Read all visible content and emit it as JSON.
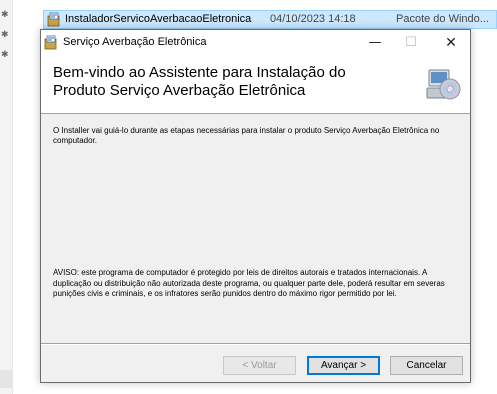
{
  "explorer": {
    "file_name": "InstaladorServicoAverbacaoEletronica",
    "file_date": "04/10/2023 14:18",
    "file_type": "Pacote do Windo..."
  },
  "window": {
    "title": "Serviço Averbação Eletrônica",
    "minimize_glyph": "—",
    "maximize_glyph": "☐",
    "close_glyph": "✕"
  },
  "banner": {
    "title_line1": "Bem-vindo ao Assistente para Instalação do",
    "title_line2": "Produto Serviço Averbação Eletrônica"
  },
  "content": {
    "intro": "O Installer vai guiá-lo durante as etapas necessárias para instalar o produto Serviço Averbação Eletrônica no computador.",
    "warning": "AVISO: este programa de computador é protegido por leis de direitos autorais e tratados internacionais. A duplicação ou distribuição não autorizada deste programa, ou qualquer parte dele, poderá resultar em severas punições civis e criminais, e os infratores serão punidos dentro do máximo rigor permitido por lei."
  },
  "buttons": {
    "back": "< Voltar",
    "next": "Avançar >",
    "cancel": "Cancelar"
  },
  "colors": {
    "selection": "#cce8ff",
    "accent": "#0078d7"
  }
}
